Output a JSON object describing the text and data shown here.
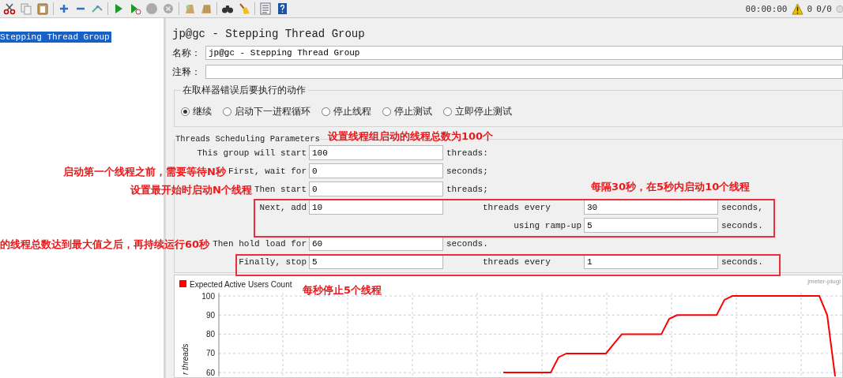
{
  "toolbar": {
    "timer": "00:00:00",
    "warning_count": "0",
    "threads": "0/0"
  },
  "tree": {
    "items": [
      {
        "label": "Stepping Thread Group",
        "selected": true
      }
    ]
  },
  "panel": {
    "title": "jp@gc - Stepping Thread Group",
    "name_label": "名称：",
    "name_value": "jp@gc - Stepping Thread Group",
    "comment_label": "注释："
  },
  "on_error": {
    "title": "在取样器错误后要执行的动作",
    "options": [
      {
        "label": "继续",
        "selected": true
      },
      {
        "label": "启动下一进程循环",
        "selected": false
      },
      {
        "label": "停止线程",
        "selected": false
      },
      {
        "label": "停止测试",
        "selected": false
      },
      {
        "label": "立即停止测试",
        "selected": false
      }
    ]
  },
  "schedule": {
    "title": "Threads Scheduling Parameters",
    "rows": [
      {
        "label": "This group will start",
        "value": "100",
        "unit": "threads:"
      },
      {
        "label": "First, wait for",
        "value": "0",
        "unit": "seconds;"
      },
      {
        "label": "Then start",
        "value": "0",
        "unit": "threads;"
      },
      {
        "label": "Next, add",
        "value": "10",
        "label_2": "threads every",
        "value_2": "30",
        "unit_2": "seconds,"
      },
      {
        "label_2": "using ramp-up",
        "value_2": "5",
        "unit_2": "seconds."
      },
      {
        "label": "Then hold load for",
        "value": "60",
        "unit": "seconds."
      },
      {
        "label": "Finally, stop",
        "value": "5",
        "label_2": "threads every",
        "value_2": "1",
        "unit_2": "seconds."
      }
    ]
  },
  "chart": {
    "credit": "jmeter-plugi",
    "axis_label": "r threads",
    "chart_data": {
      "type": "line",
      "grid": true,
      "ylim": [
        58,
        100
      ],
      "yticks": [
        60,
        70,
        80,
        90,
        100
      ],
      "categories": [
        null,
        null,
        null,
        null,
        null,
        null,
        null,
        null,
        null,
        null,
        null,
        null,
        null,
        null,
        null,
        null,
        null,
        null,
        null,
        null,
        null,
        null,
        null,
        null,
        null,
        null,
        null,
        null,
        null,
        null,
        null,
        null,
        null,
        null,
        null,
        null,
        null,
        null,
        null,
        null,
        null,
        null,
        null,
        null,
        null,
        null,
        null,
        null,
        null,
        null,
        null,
        null,
        null,
        null,
        null,
        null,
        null,
        null,
        null,
        null,
        null,
        null,
        null,
        null,
        null,
        null,
        null,
        null,
        null,
        null,
        null,
        null,
        null,
        null,
        null,
        null,
        null,
        null,
        null,
        null,
        null
      ],
      "series": [
        {
          "name": "Expected Active Users Count",
          "color": "#ff0000",
          "values": [
            null,
            null,
            null,
            null,
            null,
            null,
            null,
            null,
            null,
            null,
            null,
            null,
            null,
            null,
            null,
            null,
            null,
            null,
            null,
            null,
            null,
            null,
            null,
            null,
            null,
            null,
            null,
            null,
            null,
            null,
            null,
            null,
            null,
            null,
            null,
            null,
            60,
            60,
            60,
            60,
            60,
            60,
            60,
            68,
            70,
            70,
            70,
            70,
            70,
            70,
            75,
            80,
            80,
            80,
            80,
            80,
            80,
            88,
            90,
            90,
            90,
            90,
            90,
            90,
            98,
            100,
            100,
            100,
            100,
            100,
            100,
            100,
            100,
            100,
            100,
            100,
            100,
            90,
            58,
            null,
            null
          ]
        }
      ]
    }
  },
  "annotations": [
    {
      "text": "设置线程组启动的线程总数为100个"
    },
    {
      "text": "启动第一个线程之前，需要等待N秒"
    },
    {
      "text": "设置最开始时启动N个线程"
    },
    {
      "text": "每隔30秒，在5秒内启动10个线程"
    },
    {
      "text": "的线程总数达到最大值之后，再持续运行60秒"
    },
    {
      "text": "每秒停止5个线程"
    }
  ]
}
